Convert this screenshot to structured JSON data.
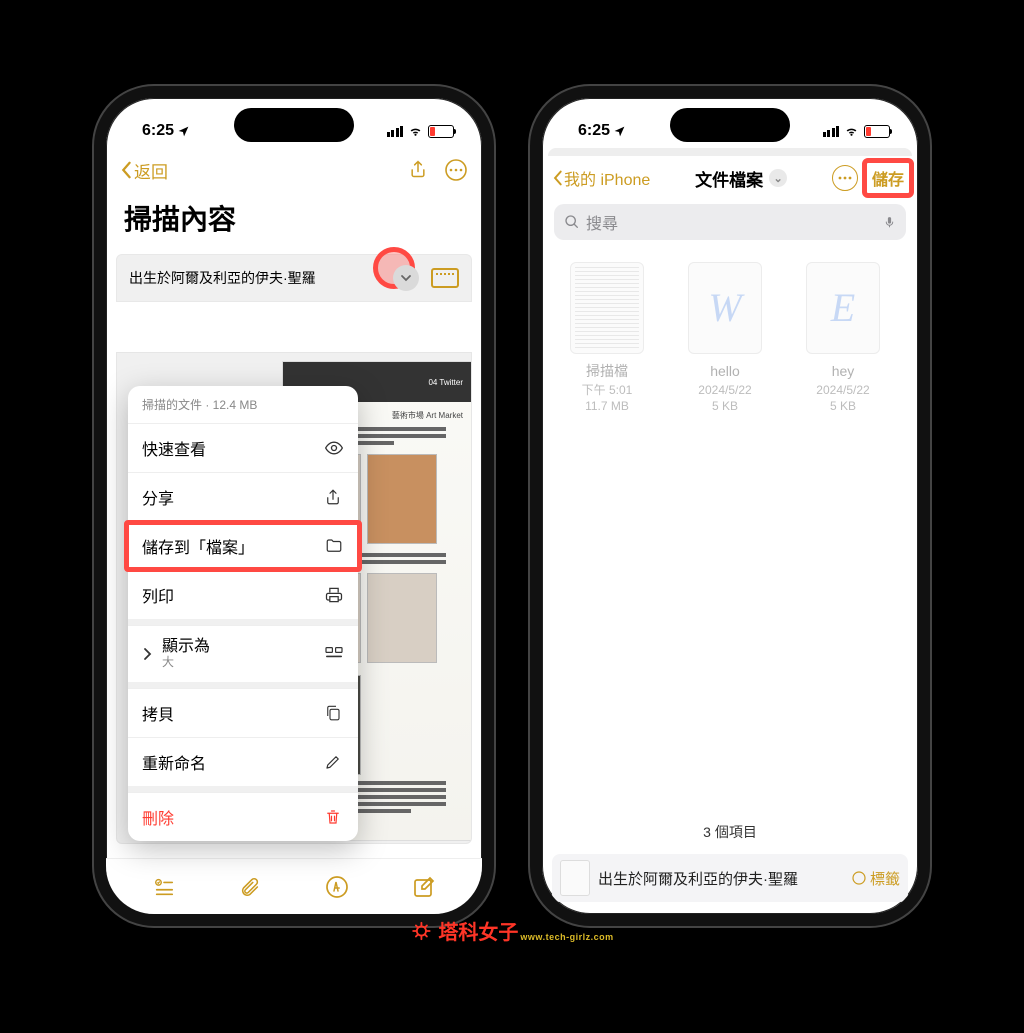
{
  "status": {
    "time": "6:25",
    "location_icon": "◤"
  },
  "left": {
    "nav": {
      "back": "返回"
    },
    "title": "掃描內容",
    "doc_label": "出生於阿爾及利亞的伊夫·聖羅",
    "menu": {
      "head": "掃描的文件 · 12.4 MB",
      "quick_look": "快速查看",
      "share": "分享",
      "save_to_files": "儲存到「檔案」",
      "print": "列印",
      "show_as": "顯示為",
      "show_as_value": "大",
      "copy": "拷貝",
      "rename": "重新命名",
      "delete": "刪除"
    },
    "scanned_header": "04 Twitter",
    "scanned_sub": "藝術市場 Art Market"
  },
  "right": {
    "nav": {
      "back": "我的 iPhone",
      "title": "文件檔案",
      "save": "儲存"
    },
    "search_placeholder": "搜尋",
    "files": [
      {
        "name": "掃描檔",
        "meta1": "下午 5:01",
        "meta2": "11.7 MB",
        "glyph": ""
      },
      {
        "name": "hello",
        "meta1": "2024/5/22",
        "meta2": "5 KB",
        "glyph": "W"
      },
      {
        "name": "hey",
        "meta1": "2024/5/22",
        "meta2": "5 KB",
        "glyph": "E"
      }
    ],
    "footer": "3 個項目",
    "save_bar": {
      "filename": "出生於阿爾及利亞的伊夫·聖羅",
      "tags": "標籤"
    }
  },
  "watermark": {
    "text": "塔科女子",
    "url": "www.tech-girlz.com"
  }
}
